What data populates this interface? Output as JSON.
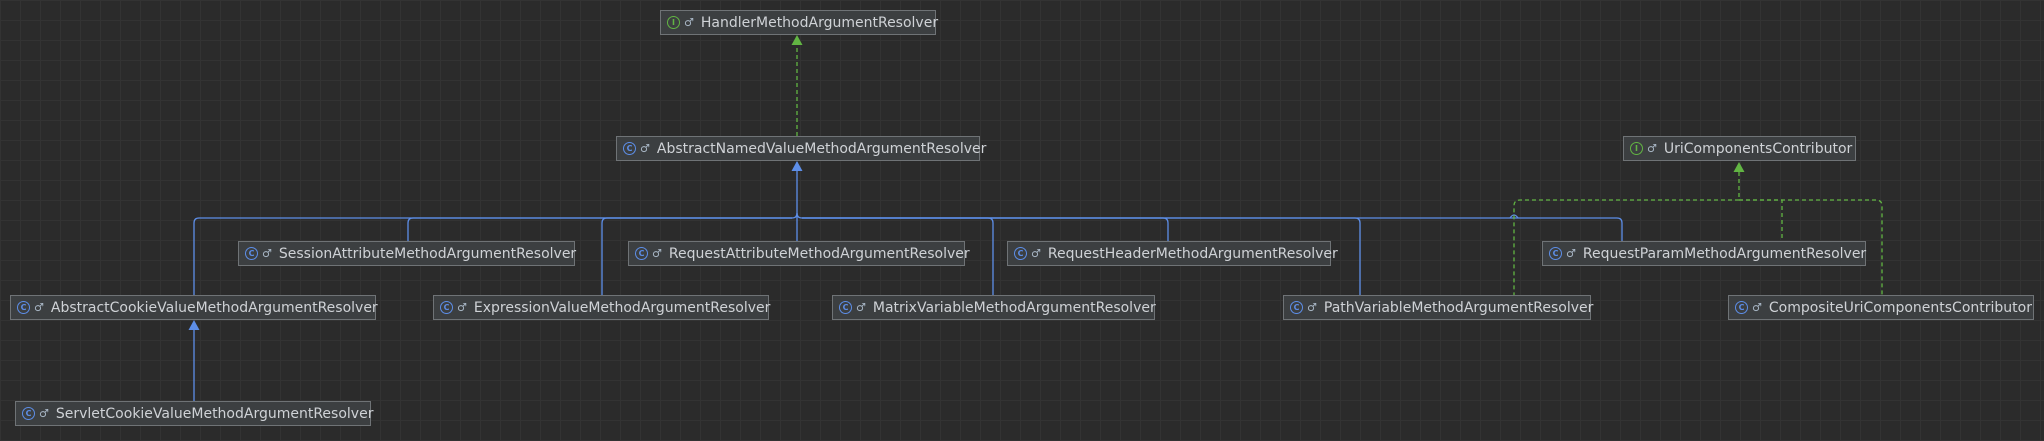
{
  "diagram": {
    "nodes": [
      {
        "id": "handler",
        "kind": "interface",
        "kind_letter": "I",
        "visibility_glyph": "♂",
        "label": "HandlerMethodArgumentResolver"
      },
      {
        "id": "abstract_named",
        "kind": "class",
        "kind_letter": "C",
        "visibility_glyph": "♂",
        "label": "AbstractNamedValueMethodArgumentResolver"
      },
      {
        "id": "uri_contributor",
        "kind": "interface",
        "kind_letter": "I",
        "visibility_glyph": "♂",
        "label": "UriComponentsContributor"
      },
      {
        "id": "session_attr",
        "kind": "class",
        "kind_letter": "C",
        "visibility_glyph": "♂",
        "label": "SessionAttributeMethodArgumentResolver"
      },
      {
        "id": "request_attr",
        "kind": "class",
        "kind_letter": "C",
        "visibility_glyph": "♂",
        "label": "RequestAttributeMethodArgumentResolver"
      },
      {
        "id": "request_header",
        "kind": "class",
        "kind_letter": "C",
        "visibility_glyph": "♂",
        "label": "RequestHeaderMethodArgumentResolver"
      },
      {
        "id": "request_param",
        "kind": "class",
        "kind_letter": "C",
        "visibility_glyph": "♂",
        "label": "RequestParamMethodArgumentResolver"
      },
      {
        "id": "abstract_cookie",
        "kind": "class",
        "kind_letter": "C",
        "visibility_glyph": "♂",
        "label": "AbstractCookieValueMethodArgumentResolver"
      },
      {
        "id": "expression_value",
        "kind": "class",
        "kind_letter": "C",
        "visibility_glyph": "♂",
        "label": "ExpressionValueMethodArgumentResolver"
      },
      {
        "id": "matrix_variable",
        "kind": "class",
        "kind_letter": "C",
        "visibility_glyph": "♂",
        "label": "MatrixVariableMethodArgumentResolver"
      },
      {
        "id": "path_variable",
        "kind": "class",
        "kind_letter": "C",
        "visibility_glyph": "♂",
        "label": "PathVariableMethodArgumentResolver"
      },
      {
        "id": "composite_uri",
        "kind": "class",
        "kind_letter": "C",
        "visibility_glyph": "♂",
        "label": "CompositeUriComponentsContributor"
      },
      {
        "id": "servlet_cookie",
        "kind": "class",
        "kind_letter": "C",
        "visibility_glyph": "♂",
        "label": "ServletCookieValueMethodArgumentResolver"
      }
    ],
    "edges": [
      {
        "from": "abstract_named",
        "to": "handler",
        "relation": "implements"
      },
      {
        "from": "session_attr",
        "to": "abstract_named",
        "relation": "extends"
      },
      {
        "from": "request_attr",
        "to": "abstract_named",
        "relation": "extends"
      },
      {
        "from": "request_header",
        "to": "abstract_named",
        "relation": "extends"
      },
      {
        "from": "request_param",
        "to": "abstract_named",
        "relation": "extends"
      },
      {
        "from": "abstract_cookie",
        "to": "abstract_named",
        "relation": "extends"
      },
      {
        "from": "expression_value",
        "to": "abstract_named",
        "relation": "extends"
      },
      {
        "from": "matrix_variable",
        "to": "abstract_named",
        "relation": "extends"
      },
      {
        "from": "path_variable",
        "to": "abstract_named",
        "relation": "extends"
      },
      {
        "from": "path_variable",
        "to": "uri_contributor",
        "relation": "implements"
      },
      {
        "from": "request_param",
        "to": "uri_contributor",
        "relation": "implements"
      },
      {
        "from": "composite_uri",
        "to": "uri_contributor",
        "relation": "implements"
      },
      {
        "from": "servlet_cookie",
        "to": "abstract_cookie",
        "relation": "extends"
      }
    ]
  },
  "colors": {
    "background": "#2b2b2b",
    "extends_edge": "#5d8ee8",
    "implements_edge": "#62b543",
    "class_icon": "#5d8ee8",
    "interface_icon": "#62b543"
  }
}
